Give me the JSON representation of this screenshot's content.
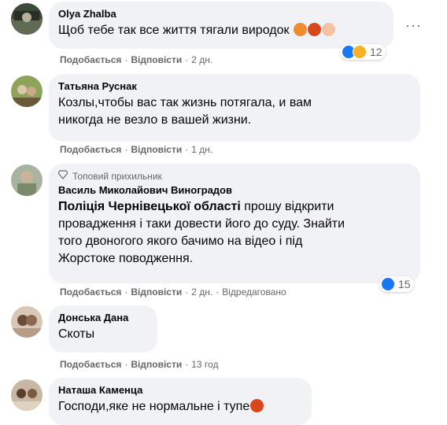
{
  "comments": [
    {
      "author": "Olya Zhalba",
      "text": "Щоб тебе так все життя тягали виродок",
      "emojis": [
        "angry-face",
        "face-with-symbols",
        "woman-facepalming"
      ],
      "actions": {
        "like": "Подобається",
        "reply": "Відповісти",
        "time": "2 дн."
      },
      "reaction_count": "12",
      "reaction_types": [
        "like",
        "sad"
      ],
      "more_label": "···"
    },
    {
      "author": "Татьяна Руснак",
      "text_lines": [
        "Козлы,чтобы вас так жизнь потягала, и вам",
        "никогда не везло в вашей жизни."
      ],
      "actions": {
        "like": "Подобається",
        "reply": "Відповісти",
        "time": "1 дн."
      }
    },
    {
      "badge": "Топовий прихильник",
      "author": "Василь Миколайович Виноградов",
      "mention": "Поліція Чернівецької області",
      "text_first": " прошу відкрити",
      "text_lines": [
        "провадження і таки довести його до суду. Знайти",
        "того двоногого якого бачимо на відео і під",
        "Жорстоке поводження."
      ],
      "actions": {
        "like": "Подобається",
        "reply": "Відповісти",
        "time": "2 дн.",
        "edited": "Відредаговано"
      },
      "reaction_count": "15",
      "reaction_types": [
        "like"
      ]
    },
    {
      "author": "Донська Дана",
      "text": "Скоты",
      "actions": {
        "like": "Подобається",
        "reply": "Відповісти",
        "time": "13 год"
      }
    },
    {
      "author": "Наташа Каменца",
      "text": "Господи,яке не нормальне і тупе",
      "emojis": [
        "face-with-symbols"
      ]
    }
  ],
  "colors": {
    "bubble": "#f0f2f5",
    "meta": "#65676b",
    "text": "#050505",
    "like_blue": "#1877f2"
  }
}
